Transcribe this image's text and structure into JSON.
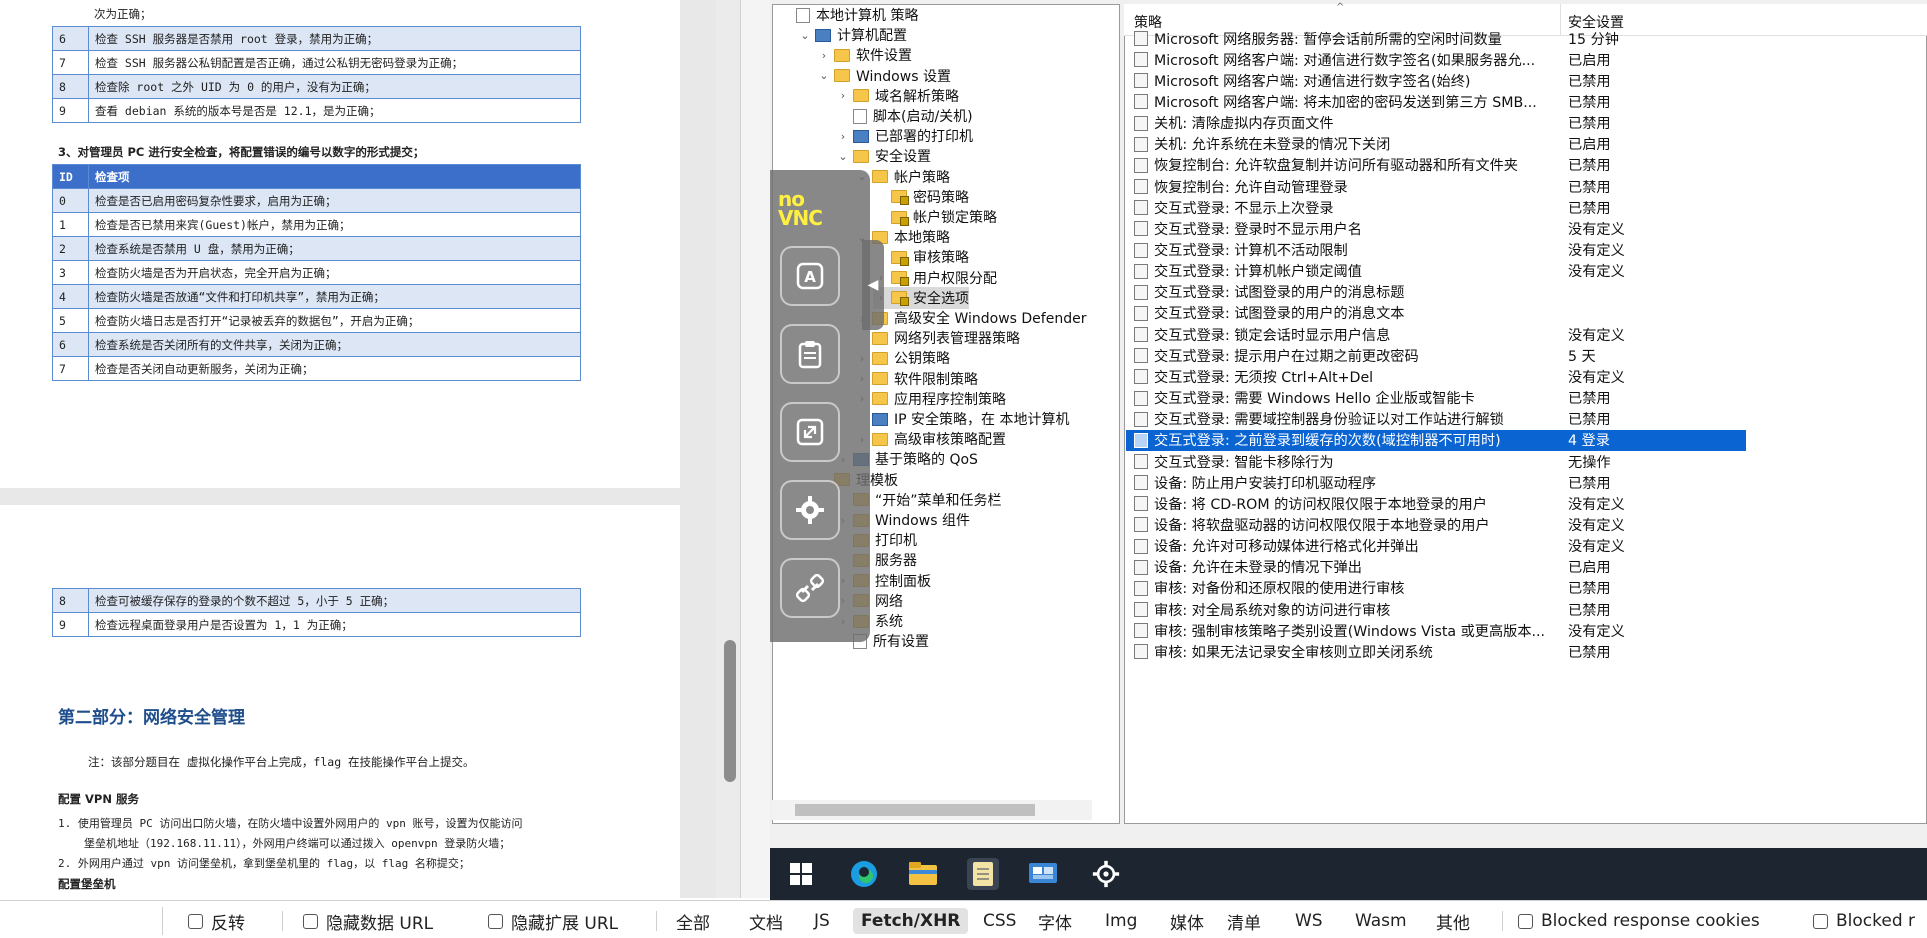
{
  "doc": {
    "top_line": "次为正确；",
    "table1": [
      {
        "id": "6",
        "text": "检查 SSH 服务器是否禁用 root 登录，禁用为正确；"
      },
      {
        "id": "7",
        "text": "检查 SSH 服务器公私钥配置是否正确，通过公私钥无密码登录为正确；"
      },
      {
        "id": "8",
        "text": "检查除 root 之外 UID 为 0 的用户，没有为正确；"
      },
      {
        "id": "9",
        "text": "查看 debian 系统的版本号是否是 12.1，是为正确；"
      }
    ],
    "section3": "3、对管理员 PC 进行安全检查，将配置错误的编号以数字的形式提交；",
    "table2_header": {
      "id": "ID",
      "text": "检查项"
    },
    "table2": [
      {
        "id": "0",
        "text": "检查是否已启用密码复杂性要求，启用为正确；"
      },
      {
        "id": "1",
        "text": "检查是否已禁用来宾(Guest)帐户，禁用为正确；"
      },
      {
        "id": "2",
        "text": "检查系统是否禁用 U 盘，禁用为正确；"
      },
      {
        "id": "3",
        "text": "检查防火墙是否为开启状态，完全开启为正确；"
      },
      {
        "id": "4",
        "text": "检查防火墙是否放通“文件和打印机共享”，禁用为正确；"
      },
      {
        "id": "5",
        "text": "检查防火墙日志是否打开“记录被丢弃的数据包”，开启为正确；"
      },
      {
        "id": "6",
        "text": "检查系统是否关闭所有的文件共享，关闭为正确；"
      },
      {
        "id": "7",
        "text": "检查是否关闭自动更新服务，关闭为正确；"
      }
    ],
    "table3": [
      {
        "id": "8",
        "text": "检查可被缓存保存的登录的个数不超过 5，小于 5 正确；"
      },
      {
        "id": "9",
        "text": "检查远程桌面登录用户是否设置为 1，1 为正确；"
      }
    ],
    "part2_title": "第二部分：网络安全管理",
    "part2_note": "注：该部分题目在 虚拟化操作平台上完成，flag 在技能操作平台上提交。",
    "vpn_title": "配置 VPN 服务",
    "vpn_item1_line1": "1.   使用管理员 PC 访问出口防火墙，在防火墙中设置外网用户的 vpn 账号，设置为仅能访问",
    "vpn_item1_line2": "堡垒机地址（192.168.11.11），外网用户终端可以通过拨入 openvpn 登录防火墙；",
    "vpn_item2": "2.   外网用户通过 vpn 访问堡垒机，拿到堡垒机里的 flag，以 flag 名称提交；",
    "bastion_title": "配置堡垒机"
  },
  "tree": {
    "items": [
      {
        "label": "本地计算机 策略",
        "icon": "doc-icon",
        "chev": ""
      },
      {
        "label": "计算机配置",
        "icon": "computer-icon",
        "chev": "⌄"
      },
      {
        "label": "软件设置",
        "icon": "folder-icon",
        "chev": "›"
      },
      {
        "label": "Windows 设置",
        "icon": "folder-icon",
        "chev": "⌄"
      },
      {
        "label": "域名解析策略",
        "icon": "folder-icon",
        "chev": "›"
      },
      {
        "label": "脚本(启动/关机)",
        "icon": "doc-icon",
        "chev": ""
      },
      {
        "label": "已部署的打印机",
        "icon": "printer-icon",
        "chev": "›"
      },
      {
        "label": "安全设置",
        "icon": "folder-icon",
        "chev": "⌄"
      },
      {
        "label": "帐户策略",
        "icon": "folder-icon",
        "chev": "⌄"
      },
      {
        "label": "密码策略",
        "icon": "folder-lock-icon",
        "chev": ""
      },
      {
        "label": "帐户锁定策略",
        "icon": "folder-lock-icon",
        "chev": ""
      },
      {
        "label": "本地策略",
        "icon": "folder-icon",
        "chev": "⌄"
      },
      {
        "label": "审核策略",
        "icon": "folder-lock-icon",
        "chev": ""
      },
      {
        "label": "用户权限分配",
        "icon": "folder-lock-icon",
        "chev": "›"
      },
      {
        "label": "安全选项",
        "icon": "folder-lock-icon",
        "chev": "›"
      },
      {
        "label": "高级安全 Windows Defender",
        "icon": "folder-icon",
        "chev": "›"
      },
      {
        "label": "网络列表管理器策略",
        "icon": "folder-icon",
        "chev": ""
      },
      {
        "label": "公钥策略",
        "icon": "folder-icon",
        "chev": "›"
      },
      {
        "label": "软件限制策略",
        "icon": "folder-icon",
        "chev": "›"
      },
      {
        "label": "应用程序控制策略",
        "icon": "folder-icon",
        "chev": "›"
      },
      {
        "label": "IP 安全策略，在 本地计算机",
        "icon": "ipsec-icon",
        "chev": ""
      },
      {
        "label": "高级审核策略配置",
        "icon": "folder-icon",
        "chev": "›"
      },
      {
        "label": "基于策略的 QoS",
        "icon": "chart-icon",
        "chev": "›"
      },
      {
        "label": "理模板",
        "icon": "folder-icon",
        "chev": ""
      },
      {
        "label": "“开始”菜单和任务栏",
        "icon": "folder-icon",
        "chev": ""
      },
      {
        "label": "Windows 组件",
        "icon": "folder-icon",
        "chev": "›"
      },
      {
        "label": "打印机",
        "icon": "folder-icon",
        "chev": ""
      },
      {
        "label": "服务器",
        "icon": "folder-icon",
        "chev": ""
      },
      {
        "label": "控制面板",
        "icon": "folder-icon",
        "chev": "›"
      },
      {
        "label": "网络",
        "icon": "folder-icon",
        "chev": "›"
      },
      {
        "label": "系统",
        "icon": "folder-icon",
        "chev": "›"
      },
      {
        "label": "所有设置",
        "icon": "doc-icon",
        "chev": ""
      }
    ]
  },
  "list": {
    "col_policy": "策略",
    "col_setting": "安全设置",
    "rows": [
      {
        "policy": "Microsoft 网络服务器: 暂停会话前所需的空闲时间数量",
        "value": "15 分钟"
      },
      {
        "policy": "Microsoft 网络客户端: 对通信进行数字签名(如果服务器允...",
        "value": "已启用"
      },
      {
        "policy": "Microsoft 网络客户端: 对通信进行数字签名(始终)",
        "value": "已禁用"
      },
      {
        "policy": "Microsoft 网络客户端: 将未加密的密码发送到第三方 SMB...",
        "value": "已禁用"
      },
      {
        "policy": "关机: 清除虚拟内存页面文件",
        "value": "已禁用"
      },
      {
        "policy": "关机: 允许系统在未登录的情况下关闭",
        "value": "已启用"
      },
      {
        "policy": "恢复控制台: 允许软盘复制并访问所有驱动器和所有文件夹",
        "value": "已禁用"
      },
      {
        "policy": "恢复控制台: 允许自动管理登录",
        "value": "已禁用"
      },
      {
        "policy": "交互式登录: 不显示上次登录",
        "value": "已禁用"
      },
      {
        "policy": "交互式登录: 登录时不显示用户名",
        "value": "没有定义"
      },
      {
        "policy": "交互式登录: 计算机不活动限制",
        "value": "没有定义"
      },
      {
        "policy": "交互式登录: 计算机帐户锁定阈值",
        "value": "没有定义"
      },
      {
        "policy": "交互式登录: 试图登录的用户的消息标题",
        "value": ""
      },
      {
        "policy": "交互式登录: 试图登录的用户的消息文本",
        "value": ""
      },
      {
        "policy": "交互式登录: 锁定会话时显示用户信息",
        "value": "没有定义"
      },
      {
        "policy": "交互式登录: 提示用户在过期之前更改密码",
        "value": "5 天"
      },
      {
        "policy": "交互式登录: 无须按 Ctrl+Alt+Del",
        "value": "没有定义"
      },
      {
        "policy": "交互式登录: 需要 Windows Hello 企业版或智能卡",
        "value": "已禁用"
      },
      {
        "policy": "交互式登录: 需要域控制器身份验证以对工作站进行解锁",
        "value": "已禁用"
      },
      {
        "policy": "交互式登录: 之前登录到缓存的次数(域控制器不可用时)",
        "value": "4 登录",
        "selected": true
      },
      {
        "policy": "交互式登录: 智能卡移除行为",
        "value": "无操作"
      },
      {
        "policy": "设备: 防止用户安装打印机驱动程序",
        "value": "已禁用"
      },
      {
        "policy": "设备: 将 CD-ROM 的访问权限仅限于本地登录的用户",
        "value": "没有定义"
      },
      {
        "policy": "设备: 将软盘驱动器的访问权限仅限于本地登录的用户",
        "value": "没有定义"
      },
      {
        "policy": "设备: 允许对可移动媒体进行格式化并弹出",
        "value": "没有定义"
      },
      {
        "policy": "设备: 允许在未登录的情况下弹出",
        "value": "已启用"
      },
      {
        "policy": "审核: 对备份和还原权限的使用进行审核",
        "value": "已禁用"
      },
      {
        "policy": "审核: 对全局系统对象的访问进行审核",
        "value": "已禁用"
      },
      {
        "policy": "审核: 强制审核策略子类别设置(Windows Vista 或更高版本...",
        "value": "没有定义"
      },
      {
        "policy": "审核: 如果无法记录安全审核则立即关闭系统",
        "value": "已禁用"
      }
    ]
  },
  "novnc": {
    "logo_top": "no",
    "logo_bottom": "VNC"
  },
  "filterbar": {
    "invert": "反转",
    "hide_data_url": "隐藏数据 URL",
    "hide_ext_url": "隐藏扩展 URL",
    "pills": [
      "全部",
      "文档",
      "JS",
      "Fetch/XHR",
      "CSS",
      "字体",
      "Img",
      "媒体",
      "清单",
      "WS",
      "Wasm",
      "其他"
    ],
    "active_pill": "Fetch/XHR",
    "blocked_cookies": "Blocked response cookies",
    "blocked_requests": "Blocked r"
  },
  "colors": {
    "selection": "#0a64d2",
    "table_border": "#5b8bd0",
    "table_header": "#3b6fc9",
    "heading": "#1f4e8c"
  }
}
